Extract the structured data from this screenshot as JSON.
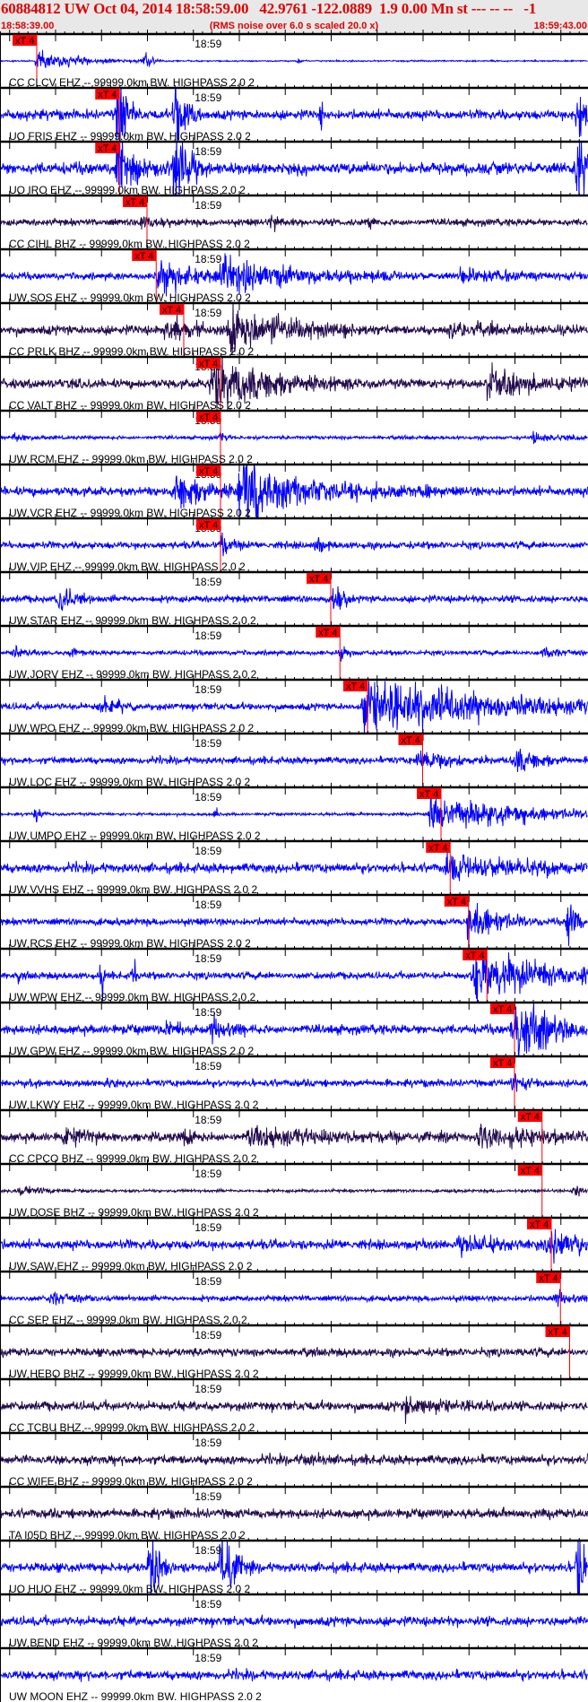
{
  "header": {
    "title": "60884812 UW Oct 04, 2014 18:58:59.00   42.9761 -122.0889  1.9 0.00 Mn st --- -- --   -1",
    "start_time": "18:58:39.00",
    "note": "(RMS noise over 6.0 s scaled 20.0 x)",
    "end_time": "18:59:43.00"
  },
  "colors": {
    "header_text": "#e00000",
    "header_bg": "#e8e8e8",
    "ehz_trace": "#0000ff",
    "bhz_trace": "#220a4e",
    "pick": "#ff0000",
    "axis": "#000000"
  },
  "chart_data": {
    "type": "line",
    "title": "60884812 UW Oct 04, 2014 18:58:59.00",
    "x_unit": "seconds after 18:58:39.00",
    "xlim": [
      0,
      64
    ],
    "tick_label": "18:59",
    "tick_label_time_s": 21,
    "major_tick_interval_s": 5,
    "pick_label": "xT 4",
    "traces": [
      {
        "label": "CC CLCV EHZ -- 99999.0km BW. HIGHPASS  2.0  2",
        "comp": "EHZ",
        "pick": 4,
        "noise": 0.6,
        "events": [
          [
            4,
            12,
            8
          ],
          [
            15.5,
            10,
            1.5
          ],
          [
            32.5,
            4,
            0.6
          ]
        ]
      },
      {
        "label": "UO FRIS EHZ -- 99999.0km BW. HIGHPASS  2.0  2",
        "comp": "EHZ",
        "pick": 13,
        "noise": 4,
        "events": [
          [
            12.8,
            60,
            1.6
          ],
          [
            19,
            60,
            2
          ],
          [
            35,
            22,
            0.2
          ],
          [
            62.8,
            60,
            1.2
          ]
        ]
      },
      {
        "label": "UO IRO EHZ -- 99999.0km BW. HIGHPASS  2.0  2",
        "comp": "EHZ",
        "pick": 13,
        "noise": 5,
        "events": [
          [
            12.8,
            60,
            1.6
          ],
          [
            15,
            8,
            3
          ],
          [
            19,
            60,
            2
          ],
          [
            62.8,
            60,
            1.2
          ]
        ]
      },
      {
        "label": "CC CIHL BHZ -- 99999.0km BW. HIGHPASS  2.0  2",
        "comp": "BHZ",
        "pick": 16,
        "noise": 3,
        "events": [
          [
            15.3,
            9,
            2
          ],
          [
            29.5,
            7,
            1.5
          ],
          [
            40,
            4,
            1
          ]
        ]
      },
      {
        "label": "UW SOS EHZ -- 99999.0km BW. HIGHPASS  2.0  2",
        "comp": "EHZ",
        "pick": 17,
        "noise": 3,
        "events": [
          [
            17,
            16,
            8
          ],
          [
            24,
            20,
            14
          ],
          [
            50,
            6,
            10
          ]
        ]
      },
      {
        "label": "CC PRLK BHZ -- 99999.0km BW. HIGHPASS  2.0  2",
        "comp": "BHZ",
        "pick": 20,
        "noise": 4,
        "events": [
          [
            18,
            18,
            4
          ],
          [
            25,
            30,
            10
          ],
          [
            49,
            8,
            6
          ]
        ]
      },
      {
        "label": "CC VALT BHZ -- 99999.0km BW. HIGHPASS  2.0  2",
        "comp": "BHZ",
        "pick": 24,
        "noise": 4,
        "events": [
          [
            23,
            34,
            10
          ],
          [
            53,
            18,
            8
          ]
        ]
      },
      {
        "label": "UW RCM EHZ -- 99999.0km BW. HIGHPASS  2.0  2",
        "comp": "EHZ",
        "pick": 24,
        "noise": 1.5,
        "events": [
          [
            1.5,
            5,
            3
          ],
          [
            24,
            6,
            1
          ],
          [
            58,
            6,
            5
          ]
        ]
      },
      {
        "label": "UW VCR EHZ -- 99999.0km BW. HIGHPASS  2.0  2",
        "comp": "EHZ",
        "pick": 24,
        "noise": 4,
        "events": [
          [
            19,
            20,
            6
          ],
          [
            26,
            30,
            13
          ],
          [
            46,
            9,
            1.5
          ]
        ]
      },
      {
        "label": "UW VIP EHZ -- 99999.0km BW. HIGHPASS  2.0  2",
        "comp": "EHZ",
        "pick": 24,
        "noise": 3,
        "events": [
          [
            24,
            14,
            1.5
          ],
          [
            34.5,
            10,
            1.2
          ]
        ]
      },
      {
        "label": "UW STAR EHZ -- 99999.0km BW. HIGHPASS  2.0  2",
        "comp": "EHZ",
        "pick": 36,
        "noise": 3,
        "events": [
          [
            6.3,
            16,
            2.5
          ],
          [
            36.3,
            18,
            1.6
          ]
        ]
      },
      {
        "label": "UW JORV EHZ -- 99999.0km BW. HIGHPASS  2.0  2",
        "comp": "EHZ",
        "pick": 37,
        "noise": 2,
        "events": [
          [
            1.5,
            6,
            2
          ],
          [
            7.8,
            6,
            1
          ],
          [
            37.2,
            8,
            1
          ],
          [
            59,
            6,
            4
          ]
        ]
      },
      {
        "label": "UW WPO EHZ -- 99999.0km BW. HIGHPASS  2.0  2",
        "comp": "EHZ",
        "pick": 40,
        "noise": 3,
        "events": [
          [
            10.8,
            12,
            3
          ],
          [
            39.5,
            30,
            25
          ]
        ]
      },
      {
        "label": "UW LOC EHZ -- 99999.0km BW. HIGHPASS  2.0  2",
        "comp": "EHZ",
        "pick": 46,
        "noise": 3,
        "events": [
          [
            45.5,
            14,
            5
          ],
          [
            56,
            14,
            4
          ]
        ]
      },
      {
        "label": "UW UMPQ EHZ -- 99999.0km BW. HIGHPASS  2.0  2",
        "comp": "EHZ",
        "pick": 48,
        "noise": 1.2,
        "events": [
          [
            3.9,
            12,
            0.8
          ],
          [
            23.5,
            10,
            0.4
          ],
          [
            46.8,
            22,
            17
          ]
        ]
      },
      {
        "label": "UW VVHS EHZ -- 99999.0km BW. HIGHPASS  2.0  2",
        "comp": "EHZ",
        "pick": 49,
        "noise": 4,
        "events": [
          [
            48.5,
            12,
            16
          ]
        ]
      },
      {
        "label": "UW RCS EHZ -- 99999.0km BW. HIGHPASS  2.0  2",
        "comp": "EHZ",
        "pick": 51,
        "noise": 3,
        "events": [
          [
            51,
            26,
            5
          ],
          [
            61.8,
            26,
            2
          ]
        ]
      },
      {
        "label": "UW WPW EHZ -- 99999.0km BW. HIGHPASS  2.0  2",
        "comp": "EHZ",
        "pick": 53,
        "noise": 3,
        "events": [
          [
            2,
            10,
            0.3
          ],
          [
            11.1,
            30,
            0.25
          ],
          [
            14.6,
            34,
            0.25
          ],
          [
            51.5,
            30,
            13
          ]
        ]
      },
      {
        "label": "UW GPW EHZ -- 99999.0km BW. HIGHPASS  2.0  2",
        "comp": "EHZ",
        "pick": 56,
        "noise": 4,
        "events": [
          [
            18,
            8,
            3
          ],
          [
            23,
            12,
            3
          ],
          [
            55.8,
            40,
            6
          ]
        ]
      },
      {
        "label": "UW LKWY EHZ -- 99999.0km BW. HIGHPASS  2.0  2",
        "comp": "EHZ",
        "pick": 56,
        "noise": 3,
        "events": [
          [
            11.5,
            6,
            1
          ],
          [
            55.8,
            12,
            2
          ]
        ]
      },
      {
        "label": "CC CPCO BHZ -- 99999.0km BW. HIGHPASS  2.0  2",
        "comp": "BHZ",
        "pick": 59,
        "noise": 4,
        "events": [
          [
            7,
            8,
            4
          ],
          [
            20,
            8,
            2
          ],
          [
            27,
            10,
            14
          ],
          [
            52,
            10,
            12
          ]
        ]
      },
      {
        "label": "UW DOSE BHZ -- 99999.0km BW. HIGHPASS  2.0  2",
        "comp": "BHZ",
        "pick": 59,
        "noise": 1.3,
        "events": [
          [
            2,
            5,
            6
          ],
          [
            62.5,
            7,
            1.5
          ]
        ]
      },
      {
        "label": "UW SAW EHZ -- 99999.0km BW. HIGHPASS  2.0  2",
        "comp": "EHZ",
        "pick": 60,
        "noise": 4,
        "events": [
          [
            50,
            6,
            10
          ],
          [
            60,
            20,
            4
          ]
        ]
      },
      {
        "label": "CC SEP EHZ -- 99999.0km BW. HIGHPASS  2.0  2",
        "comp": "EHZ",
        "pick": 61,
        "noise": 2.5,
        "events": [
          [
            5.5,
            8,
            4
          ],
          [
            60.5,
            7,
            3
          ]
        ]
      },
      {
        "label": "UW HEBO BHZ -- 99999.0km BW. HIGHPASS  2.0  2",
        "comp": "BHZ",
        "pick": 62,
        "noise": 3.5,
        "events": []
      },
      {
        "label": "CC TCBU BHZ -- 99999.0km BW. HIGHPASS  2.0  2",
        "comp": "BHZ",
        "pick": null,
        "noise": 4,
        "events": [
          [
            44,
            8,
            7
          ]
        ]
      },
      {
        "label": "CC WIFE BHZ -- 99999.0km BW. HIGHPASS  2.0  2",
        "comp": "BHZ",
        "pick": null,
        "noise": 4,
        "events": [
          [
            33,
            5,
            2
          ]
        ]
      },
      {
        "label": "TA I05D BHZ -- 99999.0km BW. HIGHPASS  2.0  2",
        "comp": "BHZ",
        "pick": null,
        "noise": 4,
        "events": []
      },
      {
        "label": "UO HUO EHZ -- 99999.0km BW. HIGHPASS  2.0  2",
        "comp": "EHZ",
        "pick": null,
        "noise": 4,
        "events": [
          [
            16.2,
            60,
            1.6
          ],
          [
            24,
            60,
            2.2
          ],
          [
            62.8,
            60,
            1.2
          ]
        ]
      },
      {
        "label": "UW BEND EHZ -- 99999.0km BW. HIGHPASS  2.0  2",
        "comp": "EHZ",
        "pick": null,
        "noise": 4,
        "events": []
      },
      {
        "label": "UW MOON EHZ -- 99999.0km BW. HIGHPASS  2.0  2",
        "comp": "EHZ",
        "pick": null,
        "noise": 4,
        "events": []
      }
    ]
  }
}
